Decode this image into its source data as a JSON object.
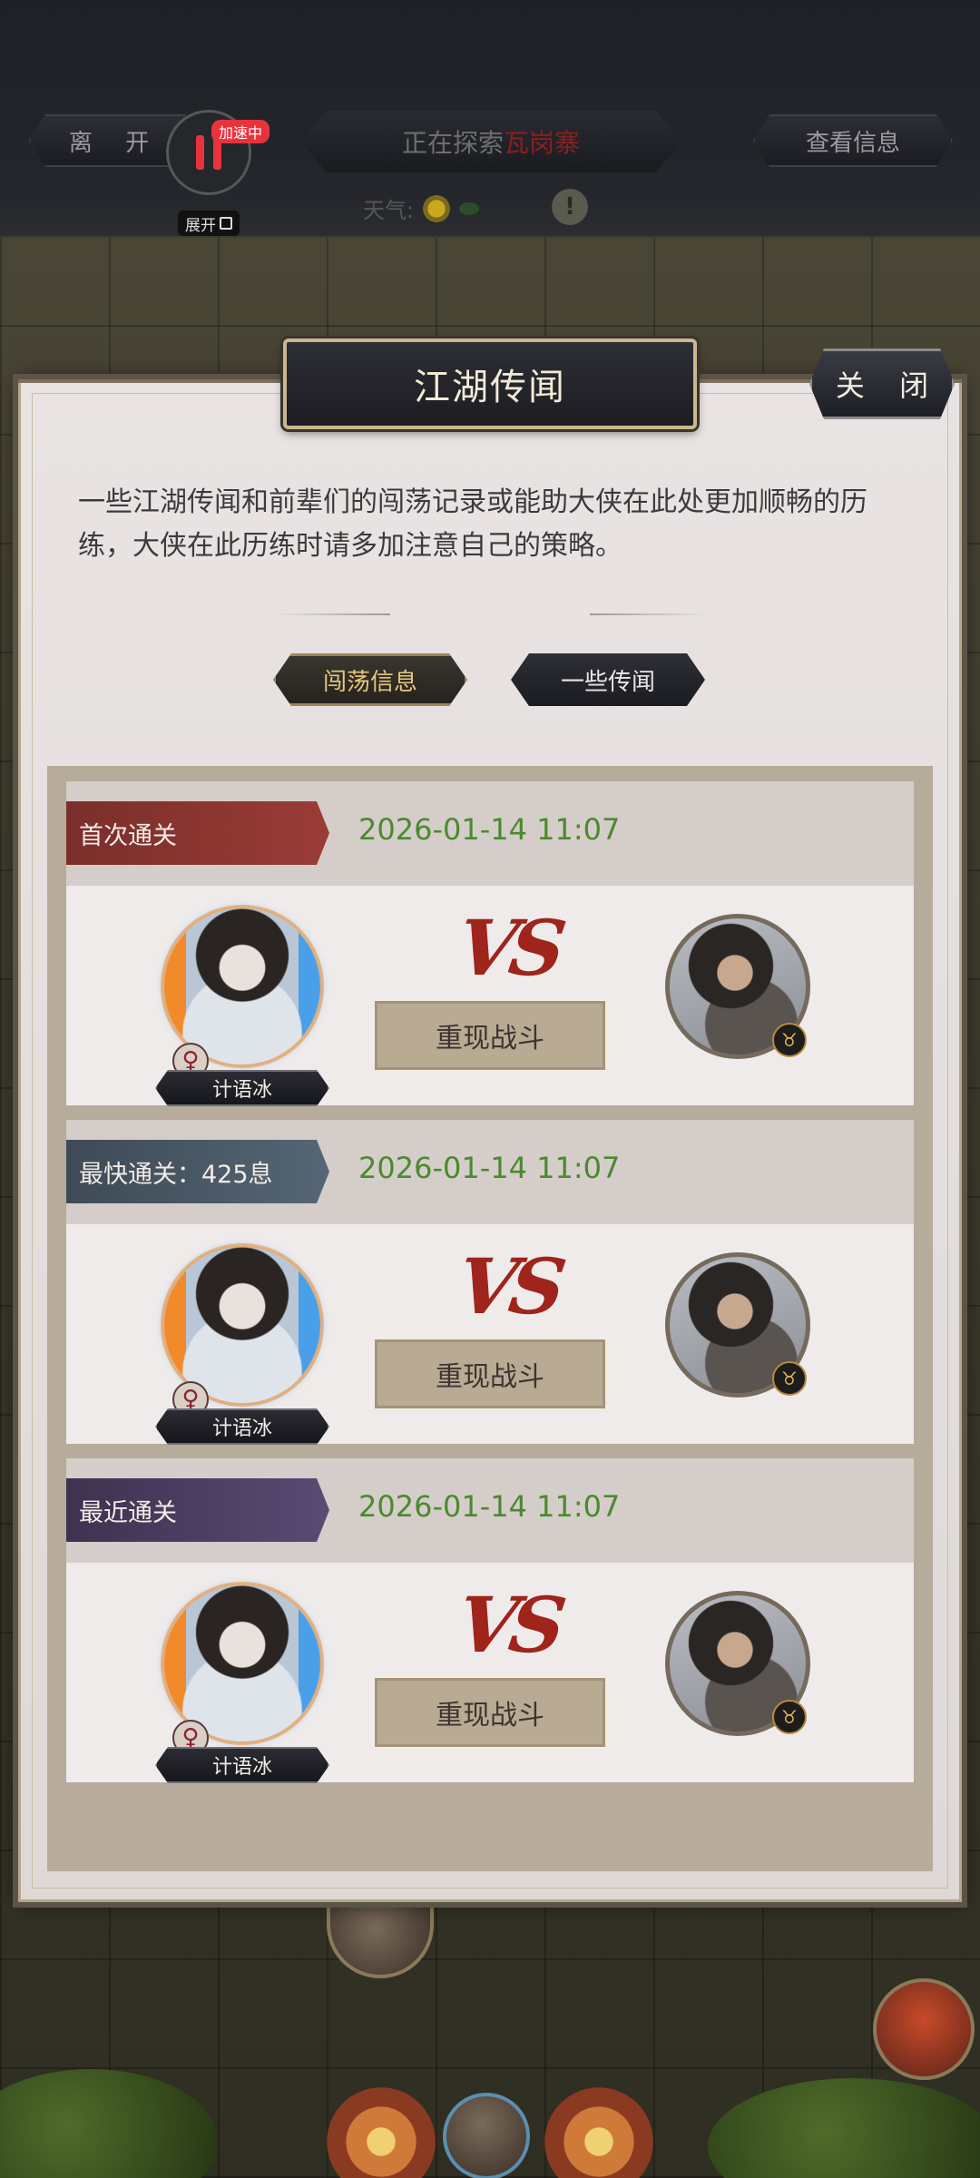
{
  "topbar": {
    "leave_label": "离 开",
    "explore_prefix": "正在探索",
    "explore_place": "瓦岗寨",
    "info_label": "查看信息",
    "speed_badge": "加速中",
    "expand_label": "展开",
    "weather_label": "天气:",
    "alert_glyph": "!"
  },
  "modal": {
    "title": "江湖传闻",
    "close_label": "关 闭",
    "intro": "一些江湖传闻和前辈们的闯荡记录或能助大侠在此处更加顺畅的历练，大侠在此历练时请多加注意自己的策略。",
    "tabs": [
      {
        "label": "闯荡信息",
        "active": true
      },
      {
        "label": "一些传闻",
        "active": false
      }
    ]
  },
  "records": [
    {
      "type_label": "首次通关",
      "ribbon_color": "#8a3530",
      "date": "2026-01-14 11:07",
      "hero_name": "计语冰",
      "gender_glyph": "♀",
      "vs": "VS",
      "replay_label": "重现战斗",
      "boss_glyph": "♉"
    },
    {
      "type_label": "最快通关：425息",
      "ribbon_color": "#4a5866",
      "date": "2026-01-14 11:07",
      "hero_name": "计语冰",
      "gender_glyph": "♀",
      "vs": "VS",
      "replay_label": "重现战斗",
      "boss_glyph": "♉"
    },
    {
      "type_label": "最近通关",
      "ribbon_color": "#4c3e64",
      "date": "2026-01-14 11:07",
      "hero_name": "计语冰",
      "gender_glyph": "♀",
      "vs": "VS",
      "replay_label": "重现战斗",
      "boss_glyph": "♉"
    }
  ],
  "icons": {
    "sun": "sun-icon",
    "leaf": "leaf-icon",
    "alert": "alert-icon",
    "pause": "pause-icon"
  },
  "colors": {
    "date_green": "#4a8a2e",
    "vs_red": "#9e241c",
    "speed_red": "#e8333c",
    "tab_gold": "#e6c77c"
  }
}
